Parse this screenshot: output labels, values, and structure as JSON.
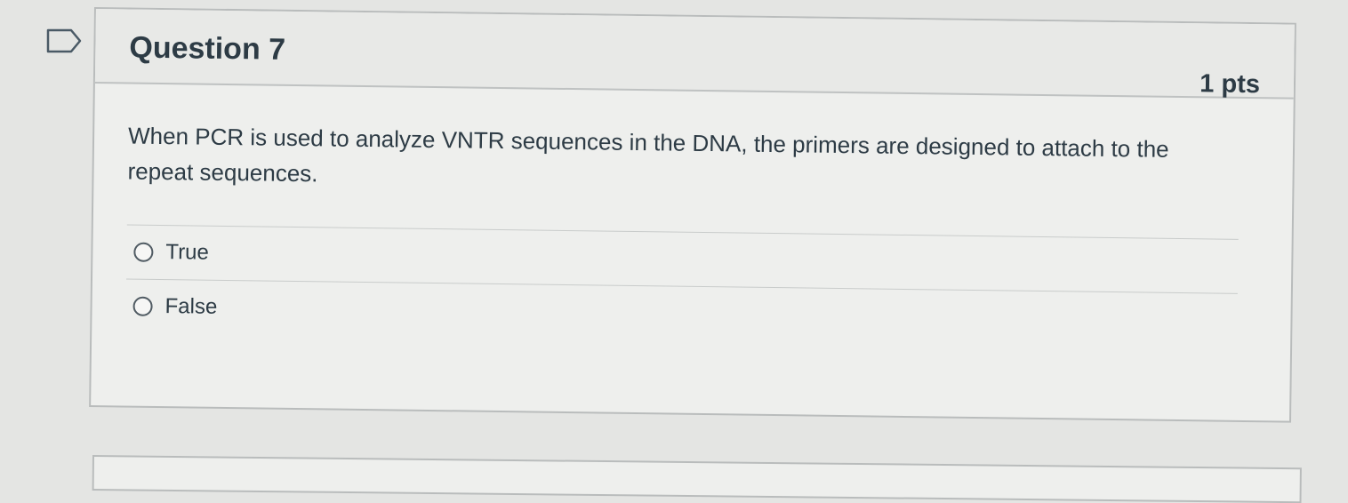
{
  "question": {
    "flag_icon": "flag-outline-icon",
    "title": "Question 7",
    "points": "1 pts",
    "text": "When PCR is used to analyze VNTR sequences in the DNA, the primers are designed to attach to the repeat sequences.",
    "answers": [
      {
        "label": "True",
        "selected": false
      },
      {
        "label": "False",
        "selected": false
      }
    ]
  }
}
